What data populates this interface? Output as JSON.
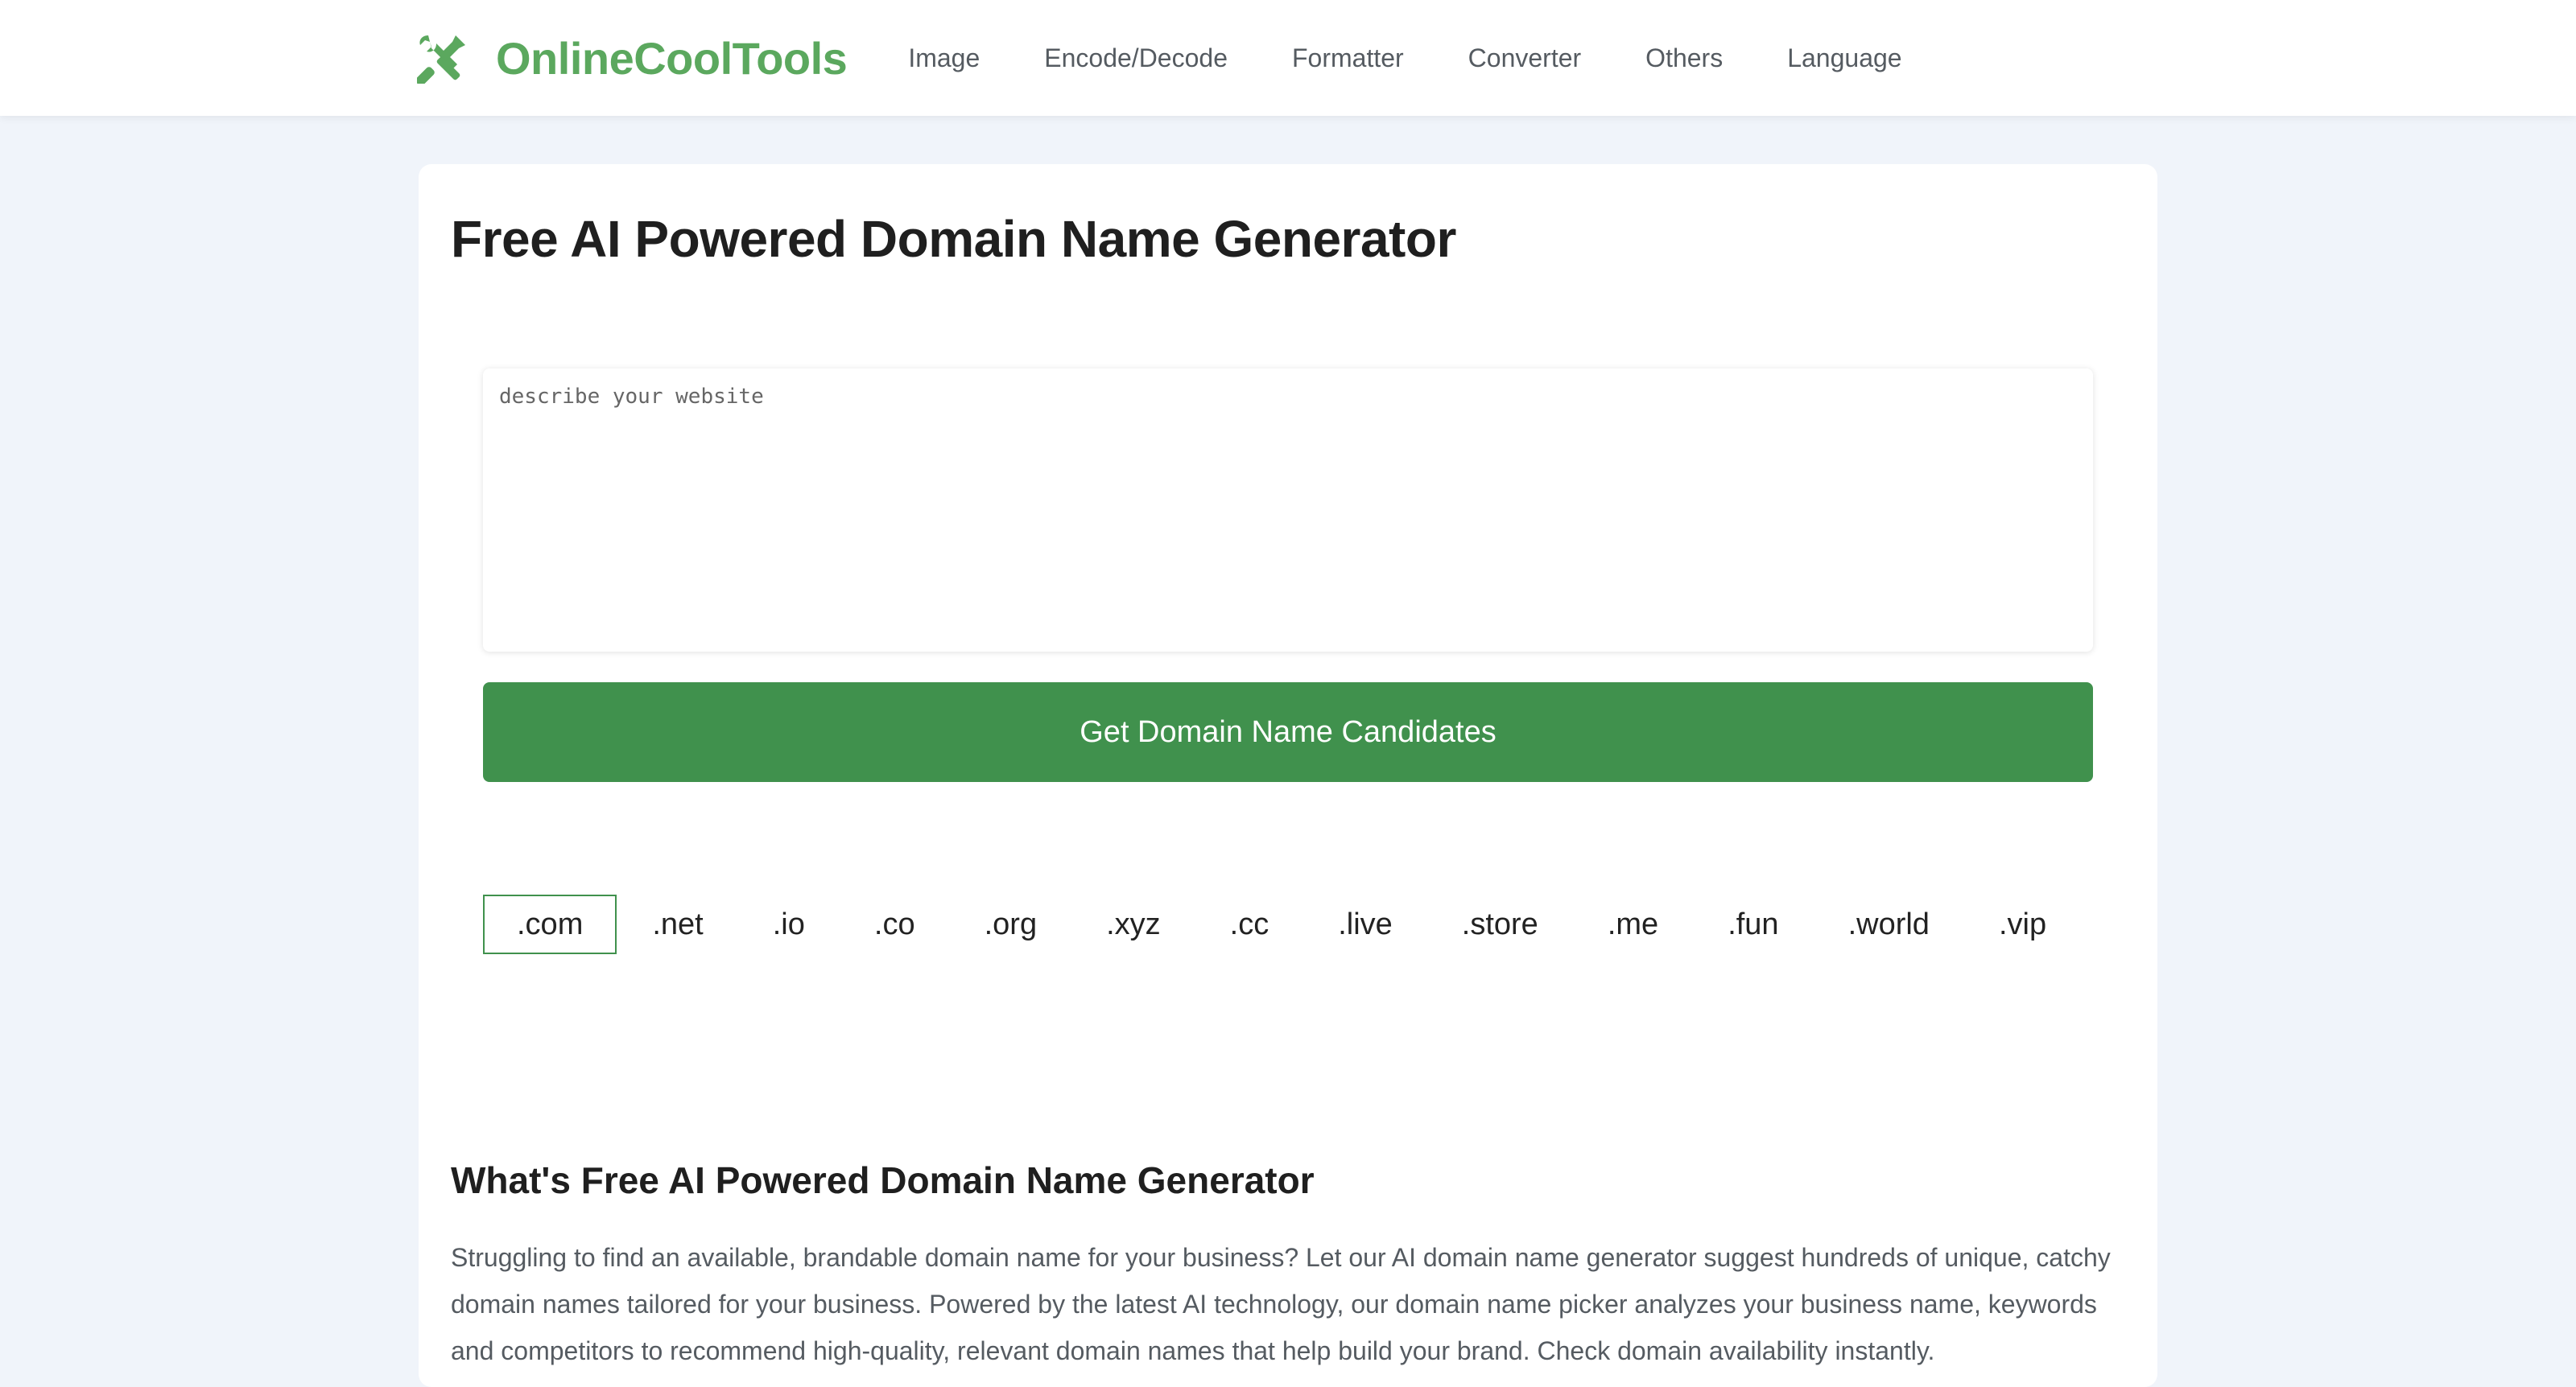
{
  "header": {
    "brand": "OnlineCoolTools",
    "logo_icon": "tools-icon",
    "nav": [
      "Image",
      "Encode/Decode",
      "Formatter",
      "Converter",
      "Others",
      "Language"
    ]
  },
  "main": {
    "title": "Free AI Powered Domain Name Generator",
    "input": {
      "placeholder": "describe your website",
      "value": ""
    },
    "submit_label": "Get Domain Name Candidates",
    "tlds": [
      ".com",
      ".net",
      ".io",
      ".co",
      ".org",
      ".xyz",
      ".cc",
      ".live",
      ".store",
      ".me",
      ".fun",
      ".world",
      ".vip"
    ],
    "selected_tld": ".com"
  },
  "about": {
    "title": "What's Free AI Powered Domain Name Generator",
    "text": "Struggling to find an available, brandable domain name for your business? Let our AI domain name generator suggest hundreds of unique, catchy domain names tailored for your business. Powered by the latest AI technology, our domain name picker analyzes your business name, keywords and competitors to recommend high-quality, relevant domain names that help build your brand. Check domain availability instantly."
  },
  "colors": {
    "brand_green": "#5ba85e",
    "button_green": "#40914d",
    "page_bg": "#f0f4fa"
  }
}
